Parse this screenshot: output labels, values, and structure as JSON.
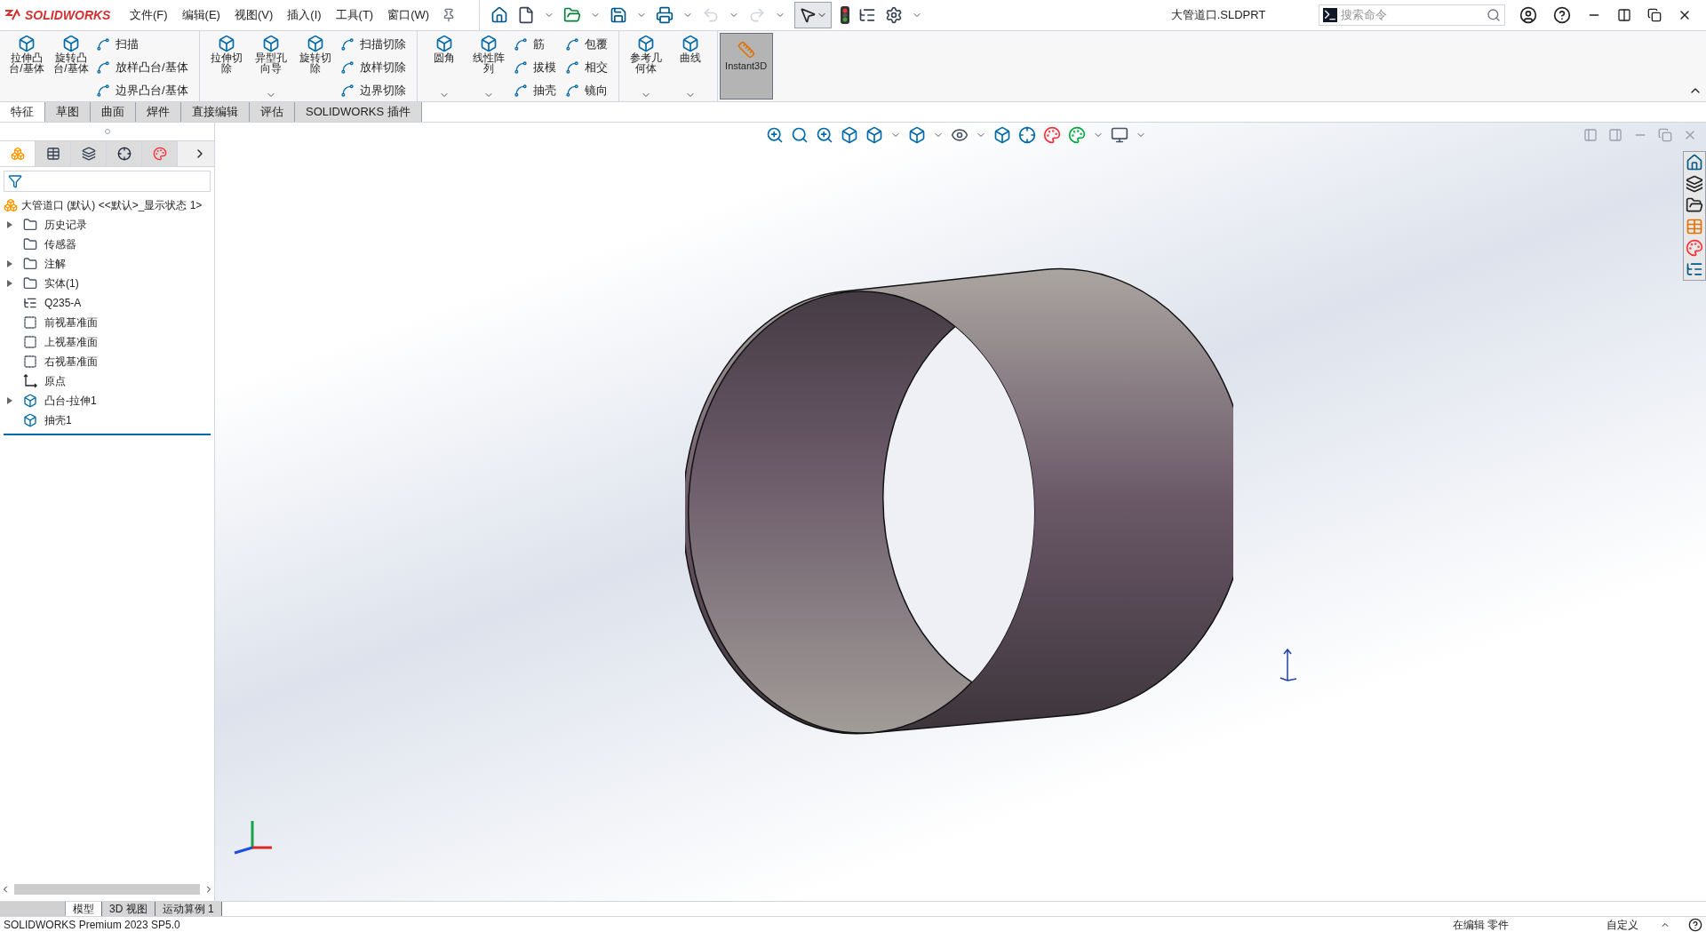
{
  "app": {
    "logo": "SOLIDWORKS",
    "title": "大管道口.SLDPRT",
    "search": {
      "placeholder": "搜索命令"
    }
  },
  "menus": [
    "文件(F)",
    "编辑(E)",
    "视图(V)",
    "插入(I)",
    "工具(T)",
    "窗口(W)"
  ],
  "ribbon": {
    "groups": [
      {
        "large": [
          {
            "label": "拉伸凸台/基体",
            "dropdown": false
          },
          {
            "label": "旋转凸台/基体",
            "dropdown": false
          }
        ],
        "small": [
          [
            "扫描",
            "放样凸台/基体",
            "边界凸台/基体"
          ]
        ]
      },
      {
        "large": [
          {
            "label": "拉伸切除",
            "dropdown": false
          },
          {
            "label": "异型孔向导",
            "dropdown": true
          },
          {
            "label": "旋转切除",
            "dropdown": false
          }
        ],
        "small": [
          [
            "扫描切除",
            "放样切除",
            "边界切除"
          ]
        ]
      },
      {
        "large": [
          {
            "label": "圆角",
            "dropdown": true
          },
          {
            "label": "线性阵列",
            "dropdown": true
          }
        ],
        "small": [
          [
            "筋",
            "拔模",
            "抽壳"
          ],
          [
            "包覆",
            "相交",
            "镜向"
          ]
        ]
      },
      {
        "large": [
          {
            "label": "参考几何体",
            "dropdown": true
          },
          {
            "label": "曲线",
            "dropdown": true
          }
        ]
      }
    ],
    "toggle": {
      "label": "Instant3D",
      "selected": true
    }
  },
  "tabs": [
    {
      "label": "特征",
      "selected": true
    },
    {
      "label": "草图",
      "selected": false
    },
    {
      "label": "曲面",
      "selected": false
    },
    {
      "label": "焊件",
      "selected": false
    },
    {
      "label": "直接编辑",
      "selected": false
    },
    {
      "label": "评估",
      "selected": false
    },
    {
      "label": "SOLIDWORKS 插件",
      "selected": false
    }
  ],
  "panel_tabs": [
    {
      "kind": "tree",
      "selected": true
    },
    {
      "kind": "property",
      "selected": false
    },
    {
      "kind": "config",
      "selected": false
    },
    {
      "kind": "target",
      "selected": false
    },
    {
      "kind": "display",
      "selected": false
    }
  ],
  "tree": {
    "root": "大管道口 (默认) <<默认>_显示状态 1>",
    "items": [
      {
        "label": "历史记录",
        "kind": "folder",
        "collapsible": true
      },
      {
        "label": "传感器",
        "kind": "folder",
        "collapsible": false
      },
      {
        "label": "注解",
        "kind": "folder",
        "collapsible": true
      },
      {
        "label": "实体(1)",
        "kind": "folder",
        "collapsible": true
      },
      {
        "label": "Q235-A",
        "kind": "material",
        "collapsible": false
      },
      {
        "label": "前视基准面",
        "kind": "plane",
        "collapsible": false
      },
      {
        "label": "上视基准面",
        "kind": "plane",
        "collapsible": false
      },
      {
        "label": "右视基准面",
        "kind": "plane",
        "collapsible": false
      },
      {
        "label": "原点",
        "kind": "origin",
        "collapsible": false
      },
      {
        "label": "凸台-拉伸1",
        "kind": "feature",
        "collapsible": true
      },
      {
        "label": "抽壳1",
        "kind": "feature",
        "collapsible": false
      }
    ]
  },
  "bottom_tabs": [
    {
      "label": "模型",
      "selected": true
    },
    {
      "label": "3D 视图",
      "selected": false
    },
    {
      "label": "运动算例 1",
      "selected": false
    }
  ],
  "status_bar": {
    "version": "SOLIDWORKS Premium 2023 SP5.0",
    "mode": "在编辑 零件",
    "units": "自定义"
  }
}
